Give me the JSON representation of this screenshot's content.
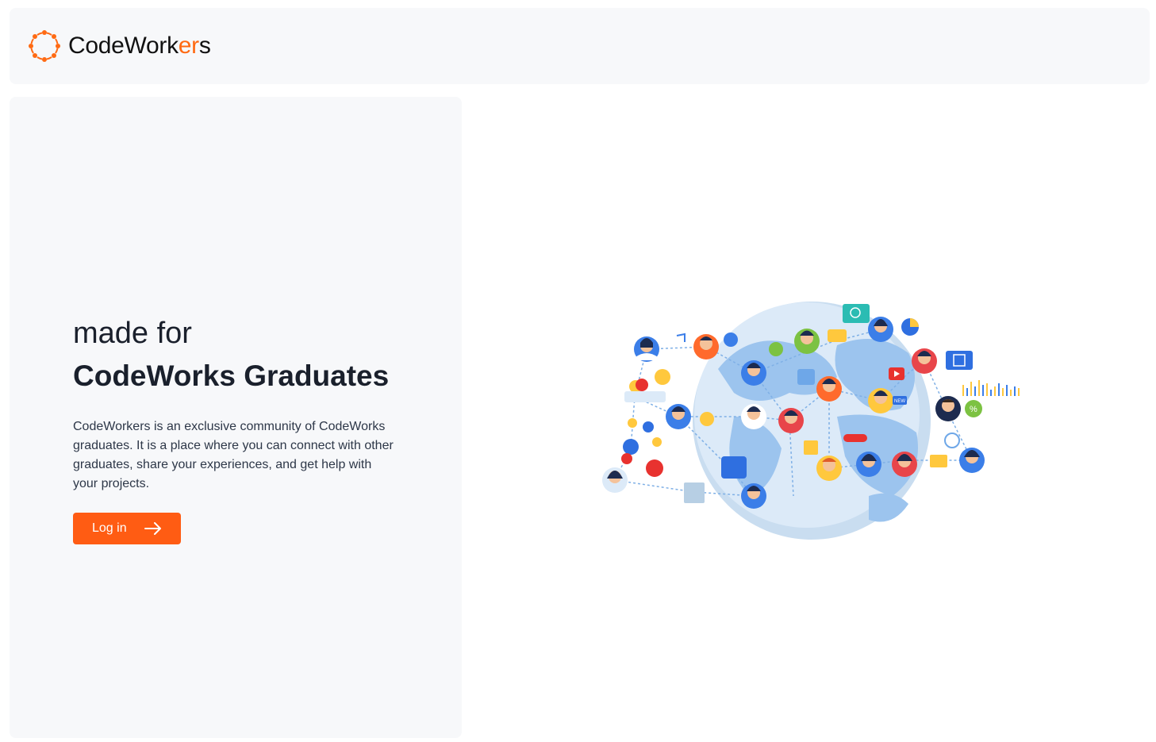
{
  "header": {
    "logo_icon": "dotted-ring-logo-icon",
    "logo_text_start": "CodeWork",
    "logo_text_accent": "er",
    "logo_text_end": "s"
  },
  "hero": {
    "subhead": "made for",
    "headline": "CodeWorks Graduates",
    "description": "CodeWorkers is an exclusive community of CodeWorks graduates. It is a place where you can connect with other graduates, share your experiences, and get help with your projects.",
    "login_label": "Log in",
    "login_icon": "arrow-right-icon"
  },
  "illustration": {
    "badge_new": "NEW"
  },
  "colors": {
    "accent": "#ff5c13",
    "panel_bg": "#f7f8fa",
    "text": "#1a202c",
    "globe": "#bcd8f5"
  }
}
